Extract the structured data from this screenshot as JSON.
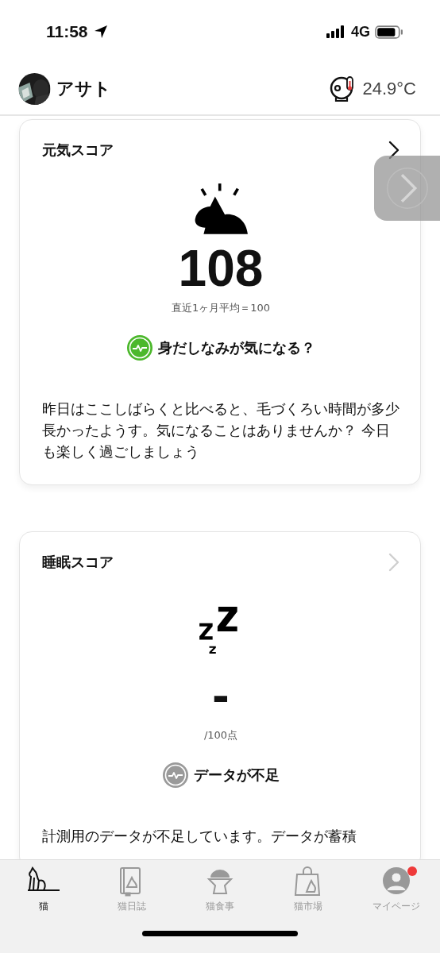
{
  "status_bar": {
    "time": "11:58",
    "network": "4G"
  },
  "header": {
    "name": "アサト",
    "temperature": "24.9°C"
  },
  "cards": [
    {
      "title": "元気スコア",
      "link_enabled": true,
      "kind": "energy",
      "score": "108",
      "subtitle": "直近1ヶ月平均＝100",
      "status": {
        "label": "身だしなみが気になる？",
        "active": true
      },
      "description": "昨日はここしばらくと比べると、毛づくろい時間が多少長かったようす。気になることはありませんか？ 今日も楽しく過ごしましょう"
    },
    {
      "title": "睡眠スコア",
      "link_enabled": false,
      "kind": "sleep",
      "score": "-",
      "subtitle": "/100点",
      "status": {
        "label": "データが不足",
        "active": false
      },
      "description": "計測用のデータが不足しています。データが蓄積"
    }
  ],
  "tabs": [
    {
      "label": "猫",
      "kind": "cat",
      "selected": true,
      "badge": false
    },
    {
      "label": "猫日誌",
      "kind": "diary",
      "selected": false,
      "badge": false
    },
    {
      "label": "猫食事",
      "kind": "food",
      "selected": false,
      "badge": false
    },
    {
      "label": "猫市場",
      "kind": "market",
      "selected": false,
      "badge": false
    },
    {
      "label": "マイページ",
      "kind": "mypage",
      "selected": false,
      "badge": true
    }
  ]
}
